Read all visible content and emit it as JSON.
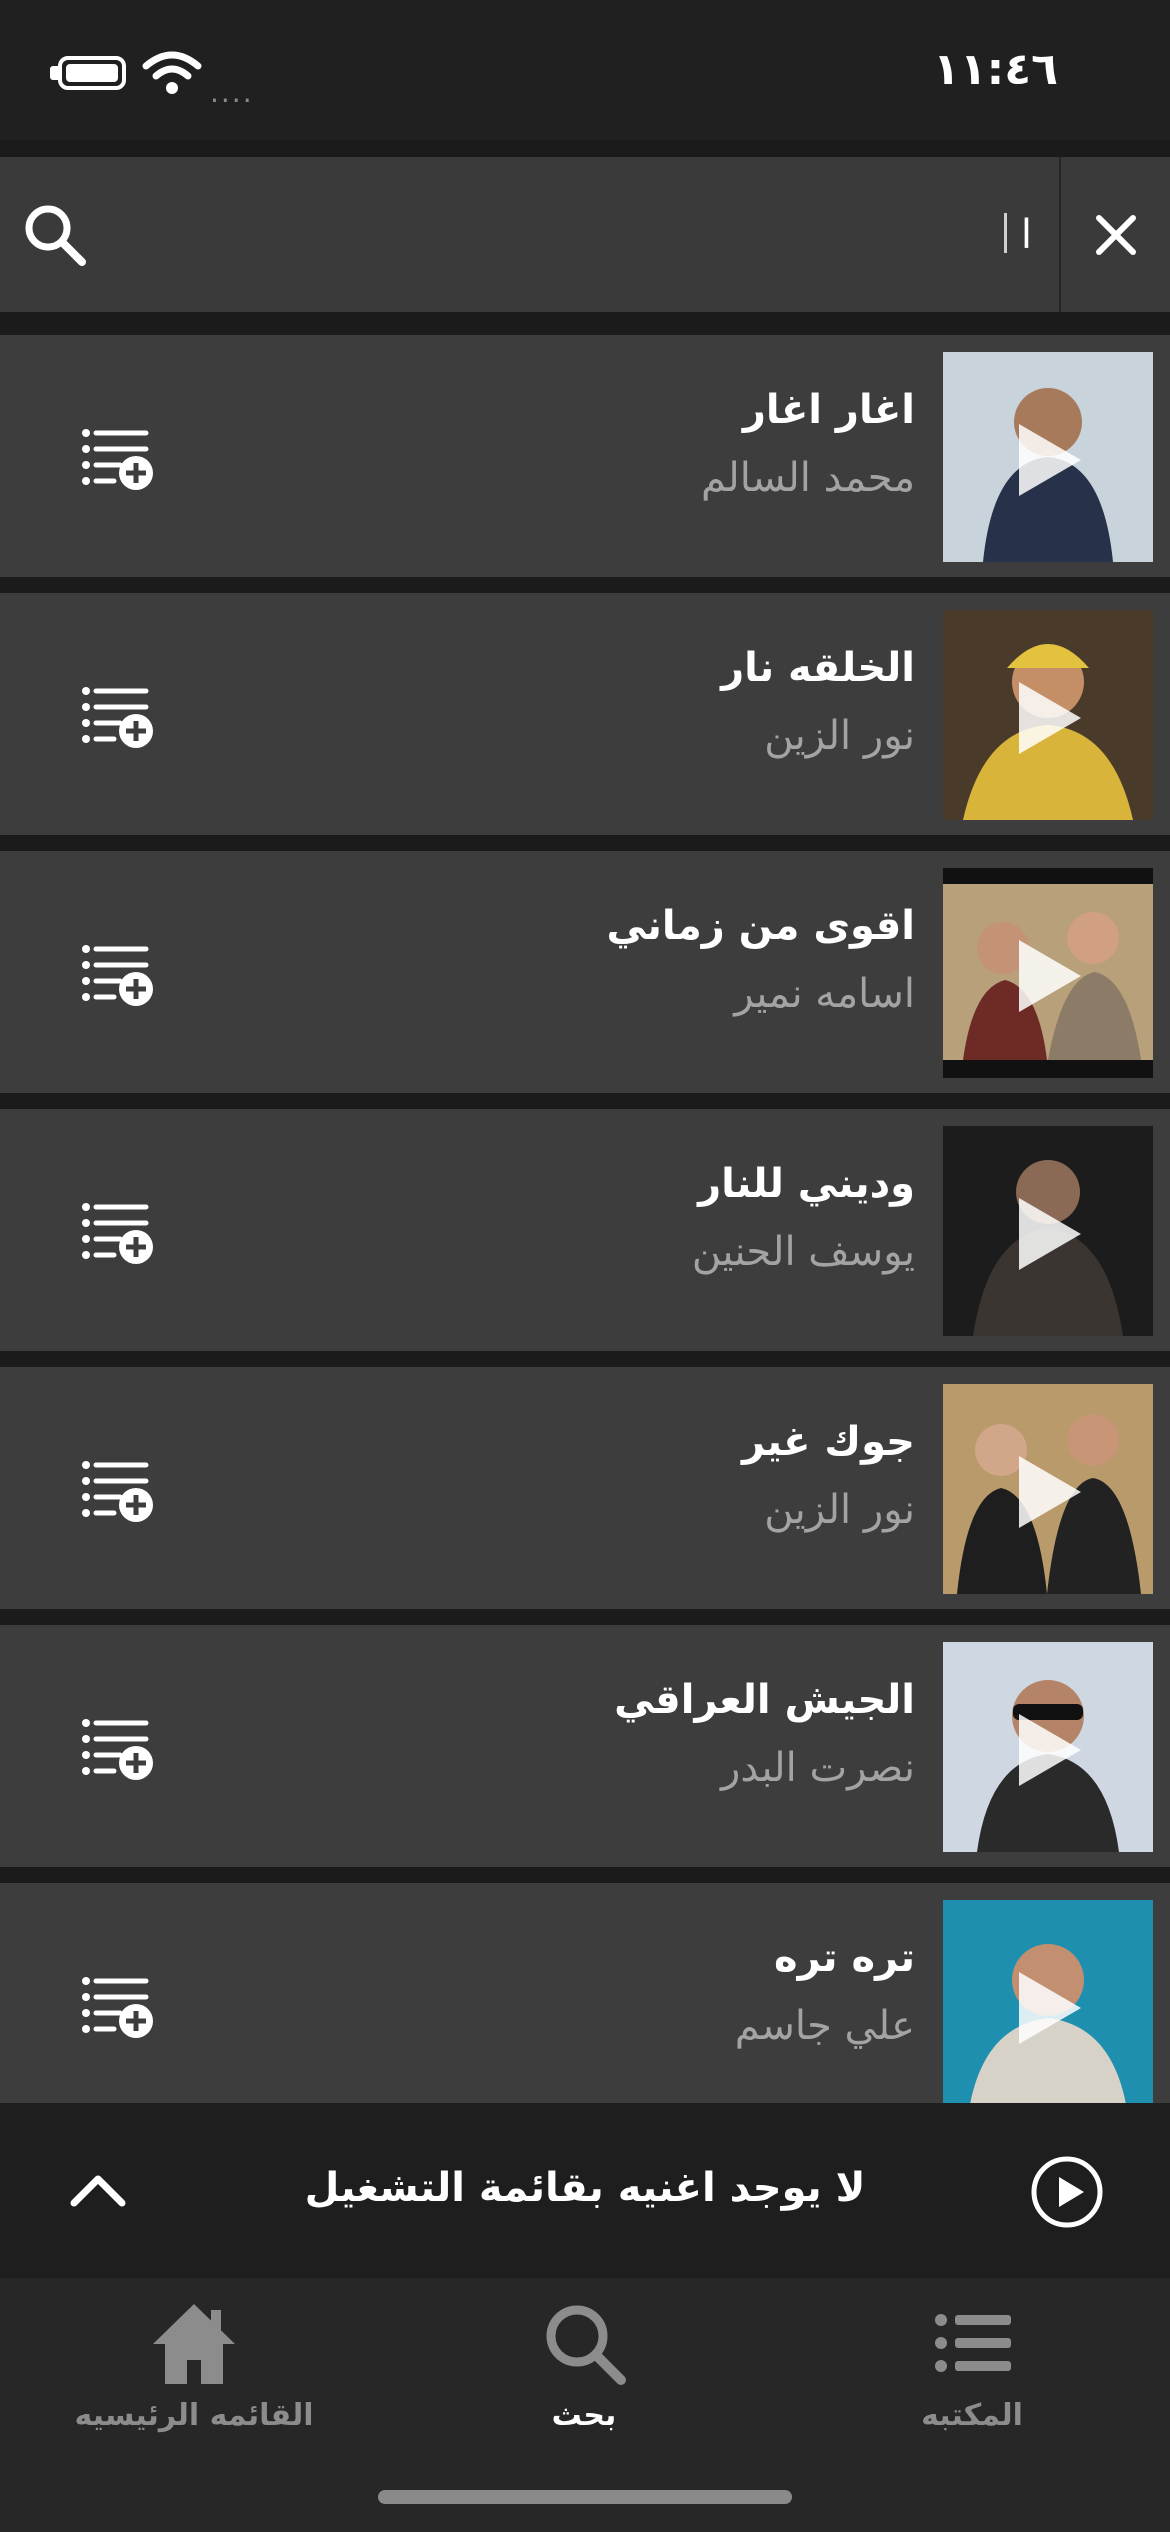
{
  "status_bar": {
    "time": "١١:٤٦",
    "signal": "...."
  },
  "search": {
    "value": "ا",
    "placeholder": ""
  },
  "songs": [
    {
      "title": "اغار اغار",
      "artist": "محمد السالم",
      "thumb_bg": "#c9d3dc",
      "thumb_fg": "#27324a"
    },
    {
      "title": "الخلقه نار",
      "artist": "نور الزين",
      "thumb_bg": "#d9b43a",
      "thumb_fg": "#5a3a22"
    },
    {
      "title": "اقوى من زماني",
      "artist": "اسامه نمير",
      "thumb_bg": "#b7a07a",
      "thumb_fg": "#6e2b26"
    },
    {
      "title": "وديني للنار",
      "artist": "يوسف الحنين",
      "thumb_bg": "#1c1c1c",
      "thumb_fg": "#3a3530"
    },
    {
      "title": "جوك غير",
      "artist": "نور الزين",
      "thumb_bg": "#b89a6b",
      "thumb_fg": "#1e1e1e"
    },
    {
      "title": "الجيش العراقي",
      "artist": "نصرت البدر",
      "thumb_bg": "#cfd8e2",
      "thumb_fg": "#2a2a2a"
    },
    {
      "title": "تره تره",
      "artist": "علي جاسم",
      "thumb_bg": "#1f8fb0",
      "thumb_fg": "#d7d2c8"
    }
  ],
  "mini_player": {
    "text": "لا يوجد اغنيه بقائمة التشغيل"
  },
  "bottom_nav": [
    {
      "label": "القائمه الرئيسيه",
      "icon": "home-icon"
    },
    {
      "label": "بحث",
      "icon": "search-icon"
    },
    {
      "label": "المكتبه",
      "icon": "library-list-icon"
    }
  ],
  "colors": {
    "accent": "#ffffff",
    "row_bg": "#3d3d3d",
    "inactive": "#8c8c8c"
  }
}
